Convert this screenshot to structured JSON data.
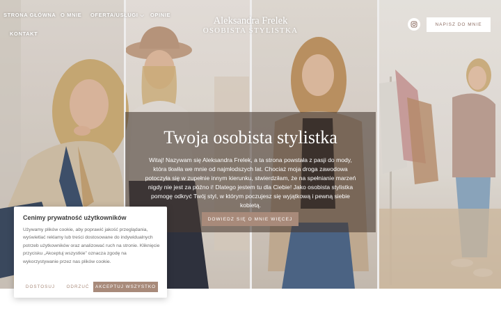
{
  "nav": {
    "items": [
      {
        "label": "Strona główna"
      },
      {
        "label": "O mnie"
      },
      {
        "label": "Oferta/Usługi"
      },
      {
        "label": "Opinie"
      },
      {
        "label": "Kontakt"
      }
    ],
    "dropdown_icon": "chevron-down-icon"
  },
  "brand": {
    "name": "Aleksandra Frelek",
    "subtitle": "Osobista Stylistka"
  },
  "header_actions": {
    "instagram_icon": "instagram-icon",
    "write_button": "Napisz do mnie"
  },
  "hero": {
    "title": "Twoja osobista stylistka",
    "text": "Witaj! Nazywam się Aleksandra Frelek, a ta strona powstała z pasji do mody, która tkwiła we mnie od najmłodszych lat. Chociaż moja droga zawodowa potoczyła się w zupełnie innym kierunku, stwierdziłam, że na spełnianie marzeń nigdy nie jest za późno i! Dlatego jestem tu dla Ciebie! Jako osobista stylistka pomogę odkryć Twój styl, w którym poczujesz się wyjątkową i pewną siebie kobietą.",
    "cta": "Dowiedz się o mnie więcej"
  },
  "cookie": {
    "title": "Cenimy prywatność użytkowników",
    "text": "Używamy plików cookie, aby poprawić jakość przeglądania, wyświetlać reklamy lub treści dostosowane do indywidualnych potrzeb użytkowników oraz analizować ruch na stronie. Kliknięcie przycisku „Akceptuj wszystkie” oznacza zgodę na wykorzystywanie przez nas plików cookie.",
    "customize": "Dostosuj",
    "reject": "Odrzuć",
    "accept": "Akceptuj wszystko"
  },
  "colors": {
    "accent": "#a88a7a",
    "overlay": "#463830"
  }
}
